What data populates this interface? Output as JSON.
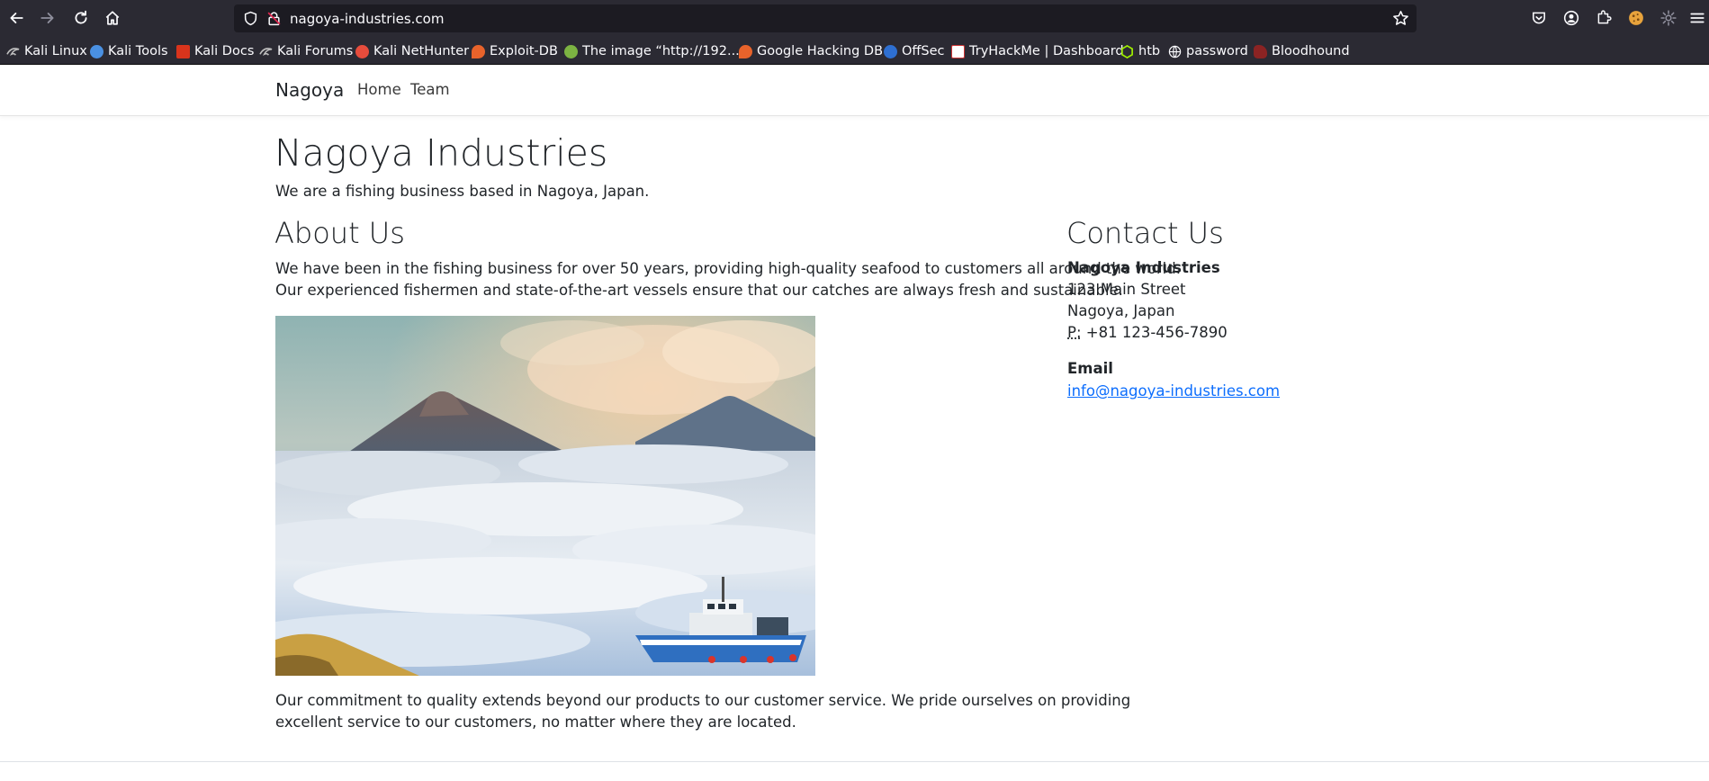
{
  "browser": {
    "url": "nagoya-industries.com",
    "bookmarks": [
      {
        "label": "Kali Linux",
        "icon": "kali-icon",
        "color": "#c0392b"
      },
      {
        "label": "Kali Tools",
        "icon": "kali-tools-icon",
        "color": "#4a90e2"
      },
      {
        "label": "Kali Docs",
        "icon": "kali-docs-icon",
        "color": "#d9341c"
      },
      {
        "label": "Kali Forums",
        "icon": "kali-forums-icon",
        "color": "#c0392b"
      },
      {
        "label": "Kali NetHunter",
        "icon": "nethunter-icon",
        "color": "#e74c3c"
      },
      {
        "label": "Exploit-DB",
        "icon": "exploit-db-icon",
        "color": "#e8632b"
      },
      {
        "label": "The image “http://192....",
        "icon": "image-icon",
        "color": "#7cb342"
      },
      {
        "label": "Google Hacking DB",
        "icon": "ghdb-icon",
        "color": "#e8632b"
      },
      {
        "label": "OffSec",
        "icon": "offsec-icon",
        "color": "#2e6fd1"
      },
      {
        "label": "TryHackMe | Dashboard",
        "icon": "tryhackme-icon",
        "color": "#ffffff"
      },
      {
        "label": "htb",
        "icon": "htb-icon",
        "color": "#9fef00"
      },
      {
        "label": "password",
        "icon": "globe-icon",
        "color": "#fbfbfe"
      },
      {
        "label": "Bloodhound",
        "icon": "bloodhound-icon",
        "color": "#8b2323"
      }
    ]
  },
  "site": {
    "brand": "Nagoya",
    "nav": [
      "Home",
      "Team"
    ],
    "hero": {
      "title": "Nagoya Industries",
      "subtitle": "We are a fishing business based in Nagoya, Japan."
    },
    "about": {
      "heading": "About Us",
      "para1_line1": "We have been in the fishing business for over 50 years, providing high-quality seafood to customers all around the world.",
      "para1_line2": "Our experienced fishermen and state-of-the-art vessels ensure that our catches are always fresh and sustainable.",
      "para2_line1": "Our commitment to quality extends beyond our products to our customer service. We pride ourselves on providing",
      "para2_line2": "excellent service to our customers, no matter where they are located."
    },
    "contact": {
      "heading": "Contact Us",
      "company": "Nagoya Industries",
      "street": "123 Main Street",
      "city": "Nagoya, Japan",
      "phone_label": "P:",
      "phone": "+81 123-456-7890",
      "email_heading": "Email",
      "email": "info@nagoya-industries.com"
    }
  }
}
